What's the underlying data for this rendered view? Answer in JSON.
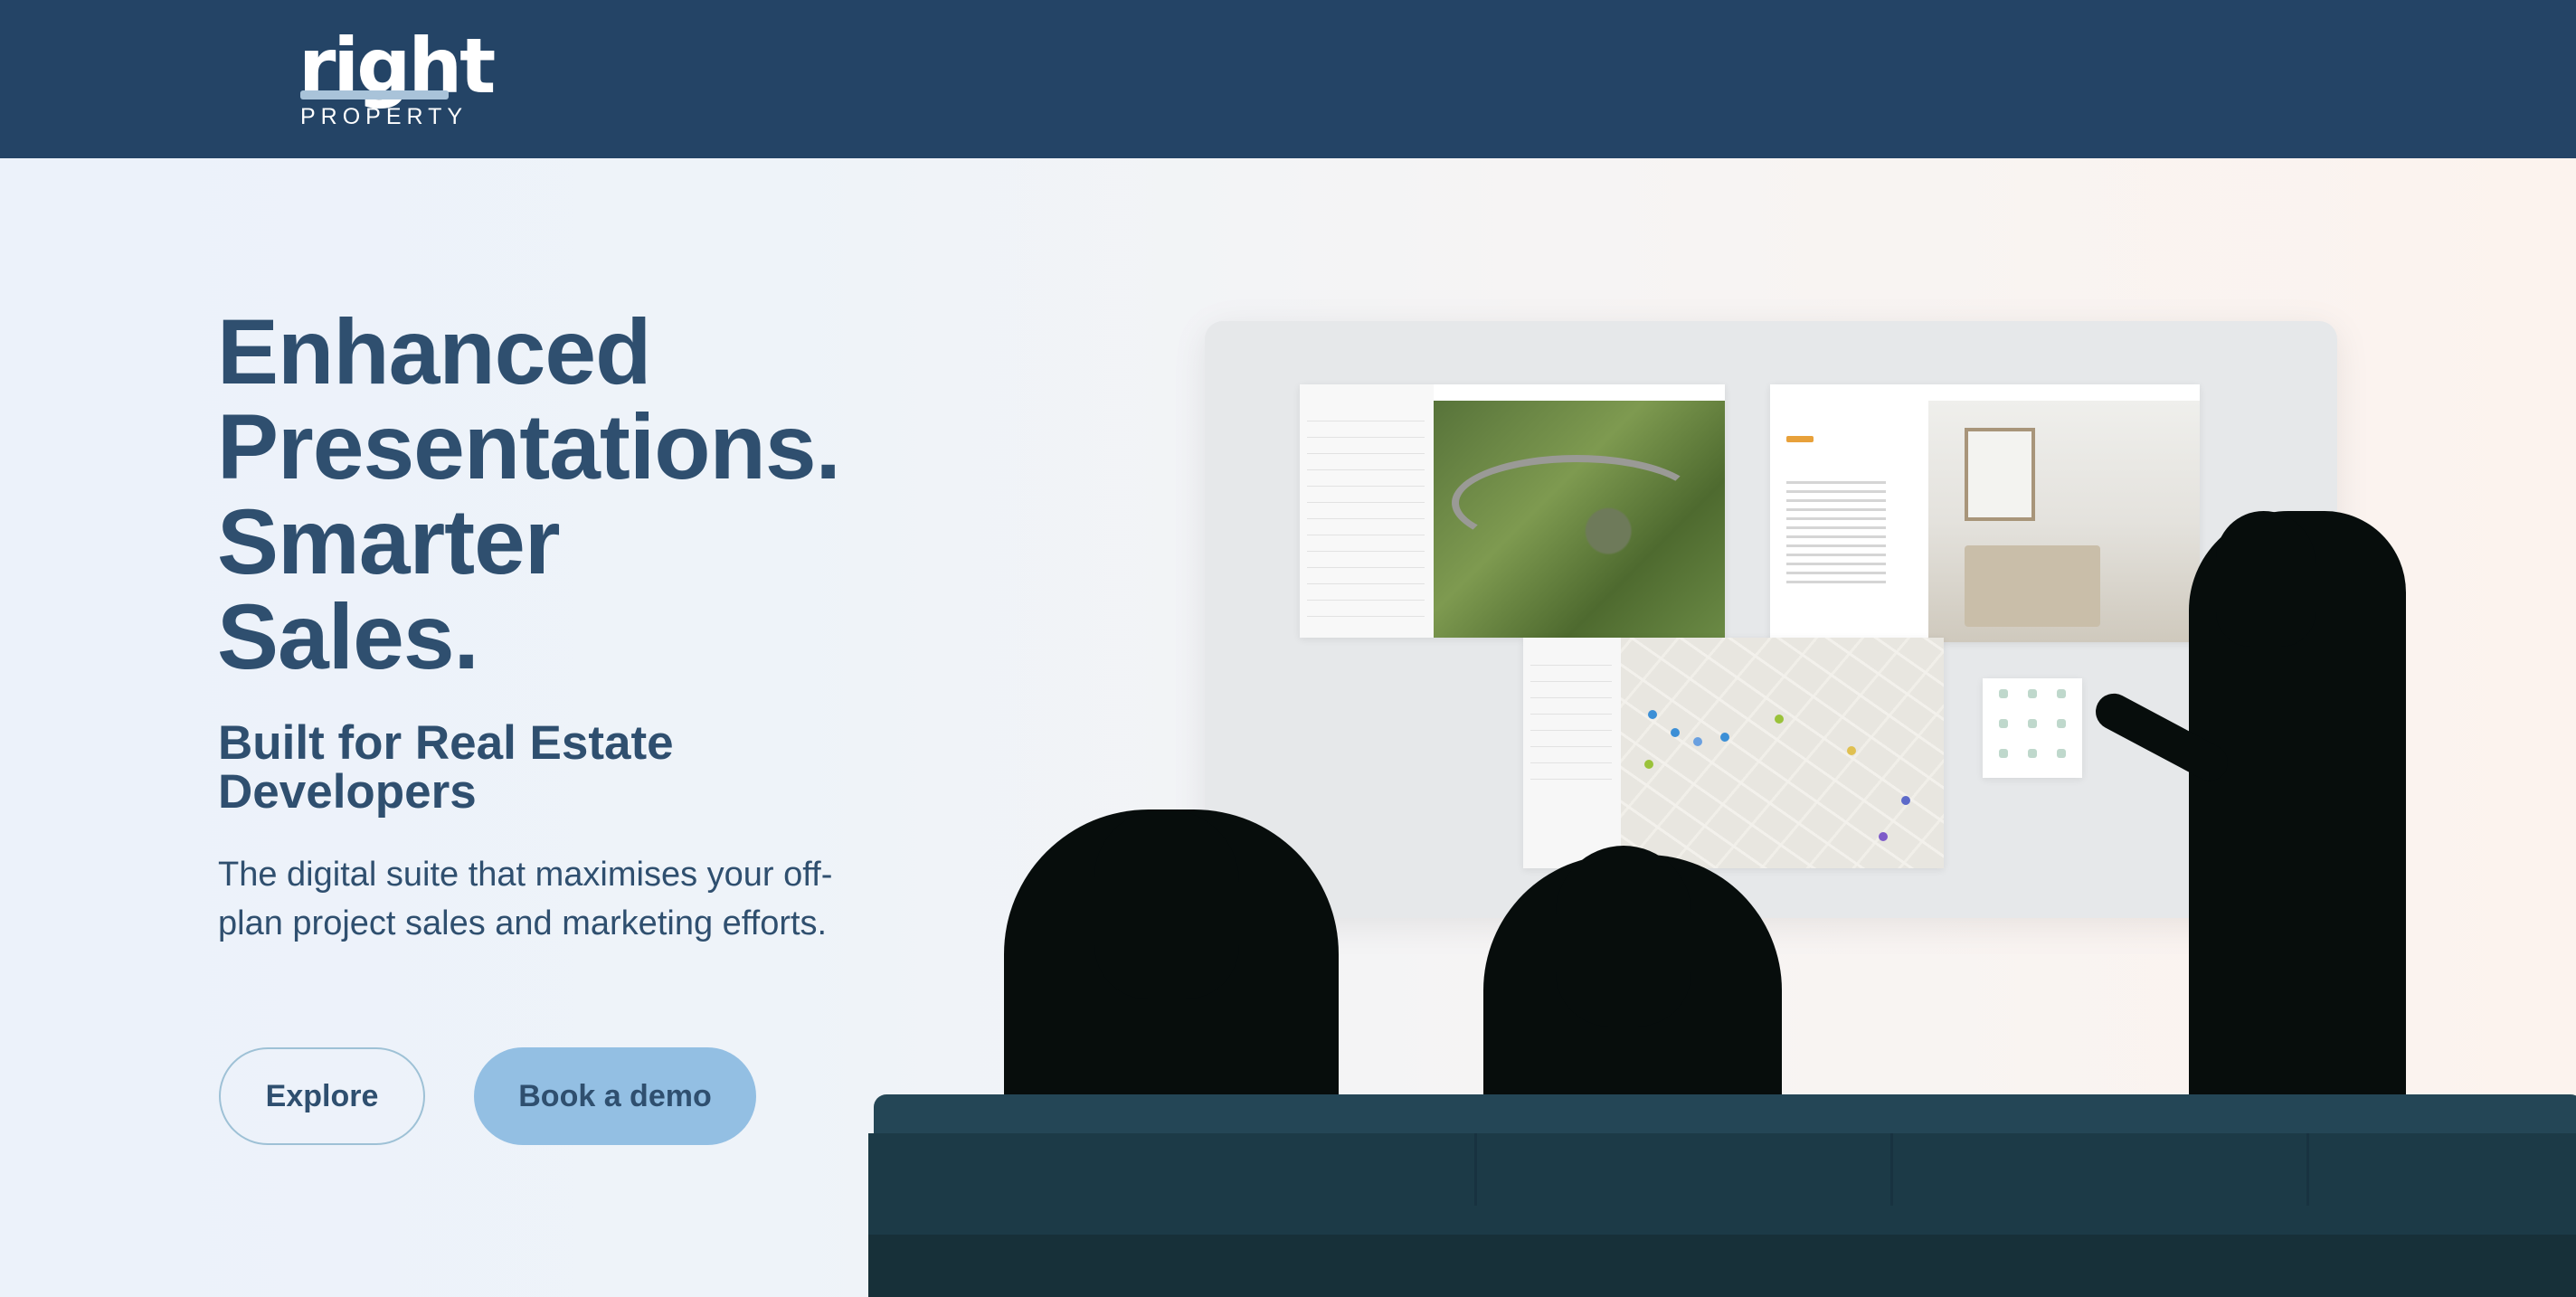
{
  "header": {
    "logo_word": "right",
    "logo_sub": "PROPERTY"
  },
  "hero": {
    "headline_lines": [
      "Enhanced",
      "Presentations.",
      "Smarter",
      "Sales."
    ],
    "subheadline": "Built for Real Estate Developers",
    "description": "The digital suite that maximises your off-plan project sales and marketing efforts.",
    "buttons": {
      "explore": "Explore",
      "demo": "Book a demo"
    }
  },
  "colors": {
    "header_bg": "#244466",
    "text": "#2f4f6f",
    "demo_button": "#93bfe3"
  }
}
